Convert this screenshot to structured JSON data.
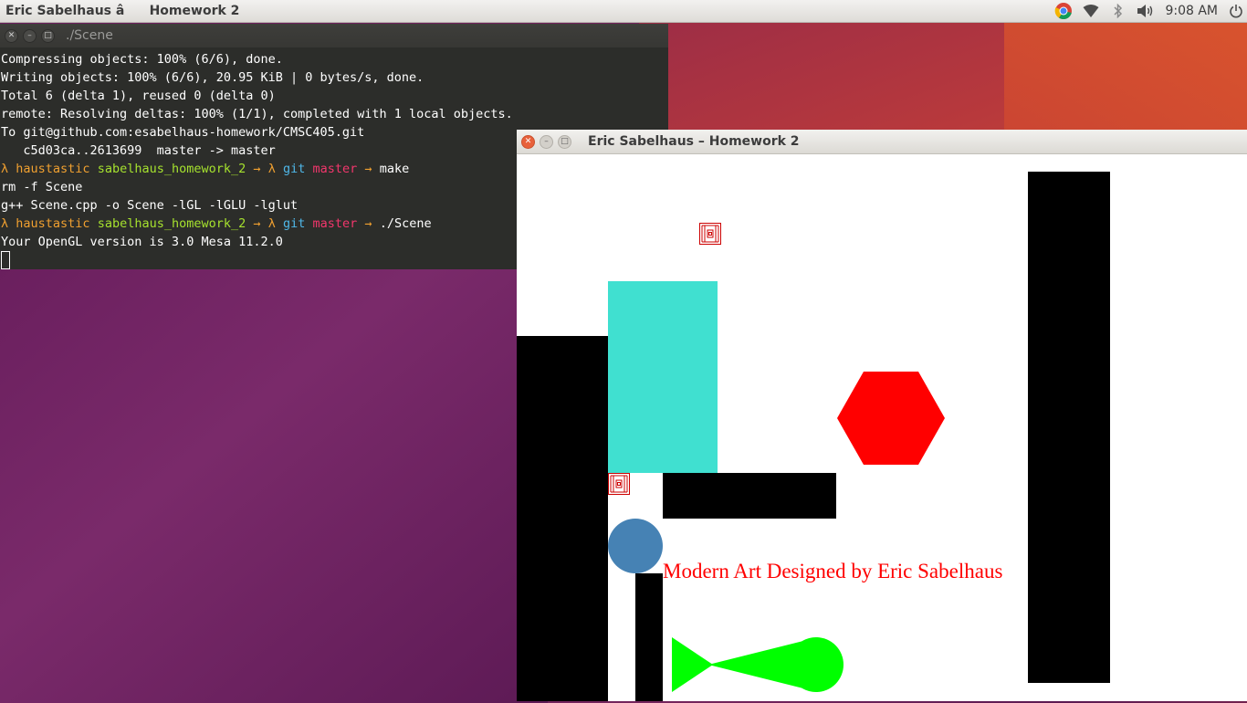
{
  "panel": {
    "active_title": "Eric Sabelhaus â Homework 2",
    "clock": "9:08 AM",
    "tray_icons": [
      "chrome-icon",
      "wifi-icon",
      "bluetooth-icon",
      "volume-icon",
      "power-icon"
    ]
  },
  "terminal": {
    "title": "./Scene",
    "lines": [
      {
        "text": "Compressing objects: 100% (6/6), done."
      },
      {
        "text": "Writing objects: 100% (6/6), 20.95 KiB | 0 bytes/s, done."
      },
      {
        "text": "Total 6 (delta 1), reused 0 (delta 0)"
      },
      {
        "text": "remote: Resolving deltas: 100% (1/1), completed with 1 local objects."
      },
      {
        "text": "To git@github.com:esabelhaus-homework/CMSC405.git"
      },
      {
        "text": "   c5d03ca..2613699  master -> master"
      }
    ],
    "prompt1": {
      "lambda": "λ",
      "host": "haustastic",
      "dir": "sabelhaus_homework_2",
      "arrow1": "→",
      "lambda2": "λ",
      "git": "git",
      "branch": "master",
      "arrow2": "→",
      "cmd": "make"
    },
    "out1": "rm -f Scene",
    "out2": "g++ Scene.cpp -o Scene -lGL -lGLU -lglut",
    "prompt2": {
      "lambda": "λ",
      "host": "haustastic",
      "dir": "sabelhaus_homework_2",
      "arrow1": "→",
      "lambda2": "λ",
      "git": "git",
      "branch": "master",
      "arrow2": "→",
      "cmd": "./Scene"
    },
    "out3": "Your OpenGL version is 3.0 Mesa 11.2.0"
  },
  "glwindow": {
    "title": "Eric Sabelhaus – Homework 2",
    "caption": "Modern Art Designed by Eric Sabelhaus",
    "colors": {
      "teal": "#40e0d0",
      "red": "#ff0000",
      "black": "#000000",
      "blue": "#4682b4",
      "green": "#00ff00"
    }
  }
}
